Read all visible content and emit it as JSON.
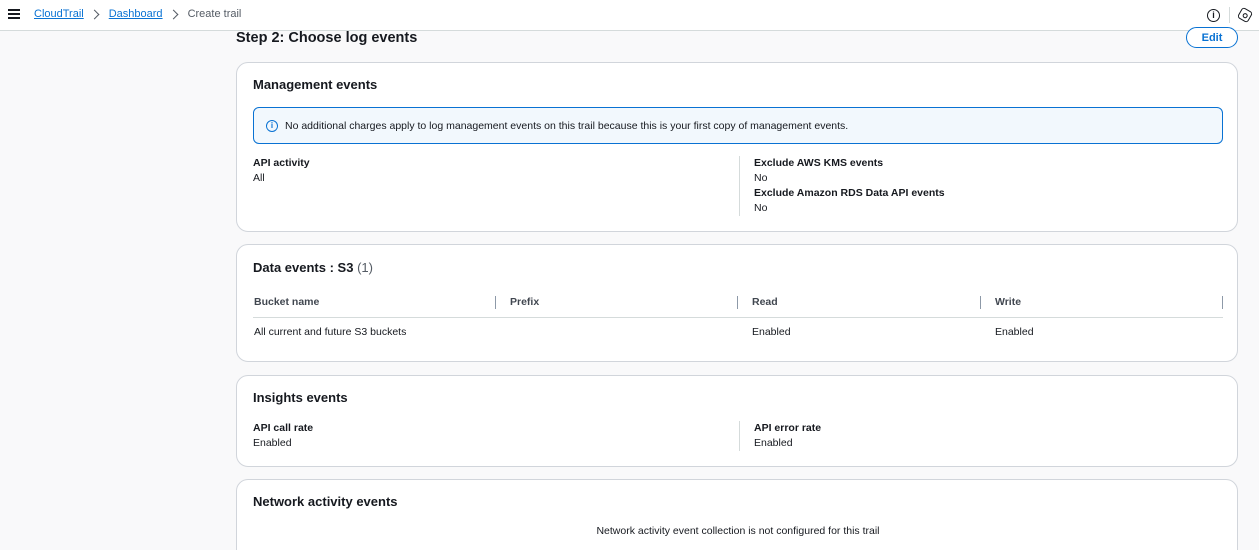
{
  "breadcrumb": {
    "items": [
      "CloudTrail",
      "Dashboard"
    ],
    "current": "Create trail"
  },
  "page": {
    "step_title": "Step 2: Choose log events",
    "edit_label": "Edit"
  },
  "management": {
    "title": "Management events",
    "alert": "No additional charges apply to log management events on this trail because this is your first copy of management events.",
    "api_activity_label": "API activity",
    "api_activity_value": "All",
    "kms_label": "Exclude AWS KMS events",
    "kms_value": "No",
    "rds_label": "Exclude Amazon RDS Data API events",
    "rds_value": "No"
  },
  "data_events": {
    "title": "Data events : S3",
    "count": "(1)",
    "columns": [
      "Bucket name",
      "Prefix",
      "Read",
      "Write"
    ],
    "rows": [
      {
        "bucket": "All current and future S3 buckets",
        "prefix": "",
        "read": "Enabled",
        "write": "Enabled"
      }
    ]
  },
  "insights": {
    "title": "Insights events",
    "call_rate_label": "API call rate",
    "call_rate_value": "Enabled",
    "error_rate_label": "API error rate",
    "error_rate_value": "Enabled"
  },
  "network": {
    "title": "Network activity events",
    "message": "Network activity event collection is not configured for this trail"
  },
  "icons": [
    "menu-icon",
    "info-icon",
    "settings-icon",
    "chevron-right-icon"
  ],
  "colors": {
    "link": "#0972d3",
    "alert_bg": "#f2f8fd",
    "text": "#16191f"
  }
}
